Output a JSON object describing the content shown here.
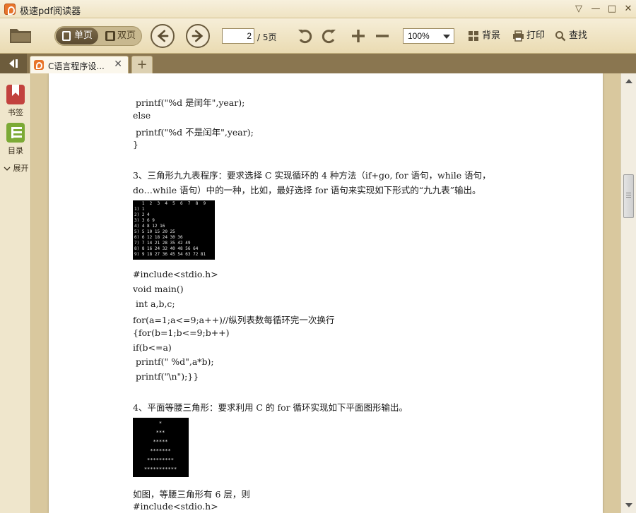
{
  "window": {
    "title": "极速pdf阅读器",
    "controls": [
      "▽",
      "—",
      "□",
      "✕"
    ]
  },
  "toolbar": {
    "view_single": "单页",
    "view_double": "双页",
    "current_page": "2",
    "total_pages": "/ 5页",
    "zoom": "100%",
    "background_label": "背景",
    "print_label": "打印",
    "find_label": "查找"
  },
  "tabs": [
    {
      "label": "C语言程序设...",
      "close": "✕"
    }
  ],
  "add_tab_label": "+",
  "sidebar": {
    "bookmark_label": "书签",
    "toc_label": "目录",
    "expand_label": "展开"
  },
  "document": {
    "lines_top": [
      " printf(\"%d 是闰年\",year);",
      "else",
      " printf(\"%d 不是闰年\",year);",
      "}"
    ],
    "q3_line1": "3、三角形九九表程序：要求选择 C 实现循环的 4 种方法（if+go, for 语句，while 语句，",
    "q3_line2": "do…while 语句）中的一种，比如，最好选择 for 语句来实现如下形式的“九九表”输出。",
    "mult_table": [
      "   1  2  3  4  5  6  7  8  9",
      "1) 1",
      "2) 2 4",
      "3) 3 6 9",
      "4) 4 8 12 16",
      "5) 5 10 15 20 25",
      "6) 6 12 18 24 30 36",
      "7) 7 14 21 28 35 42 49",
      "8) 8 16 24 32 40 48 56 64",
      "9) 9 18 27 36 45 54 63 72 81"
    ],
    "code_lines": [
      "#include<stdio.h>",
      "void main()",
      " int a,b,c;",
      "for(a=1;a<=9;a++)//纵列表数每循环完一次换行",
      "{for(b=1;b<=9;b++)",
      "if(b<=a)",
      " printf(\" %d\",a*b);",
      " printf(\"\\n\");}}"
    ],
    "q4_line": "4、平面等腰三角形：要求利用 C 的 for 循环实现如下平面图形输出。",
    "triangle": [
      "*",
      "***",
      "*****",
      "*******",
      "*********",
      "***********"
    ],
    "after_lines": [
      "如图，等腰三角形有 6 层，则",
      "#include<stdio.h>"
    ]
  },
  "colors": {
    "accent": "#e8742a",
    "frame": "#d9c89e",
    "tabbar": "#8a7650"
  }
}
